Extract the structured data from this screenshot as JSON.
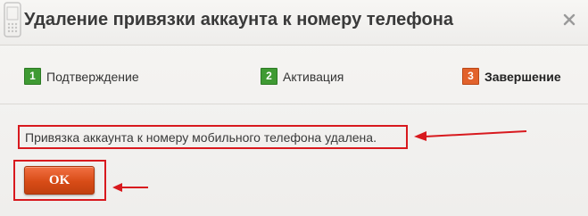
{
  "dialog": {
    "title": "Удаление привязки аккаунта к номеру телефона"
  },
  "steps": [
    {
      "number": "1",
      "label": "Подтверждение",
      "state": "done",
      "color": "#3f9a33"
    },
    {
      "number": "2",
      "label": "Активация",
      "state": "done",
      "color": "#3f9a33"
    },
    {
      "number": "3",
      "label": "Завершение",
      "state": "current",
      "color": "#e2622c"
    }
  ],
  "message": "Привязка аккаунта к номеру мобильного телефона удалена.",
  "ok_button": {
    "label": "OK"
  },
  "annotation_color": "#d8191e",
  "icons": {
    "phone": "phone-icon",
    "close": "close-icon",
    "arrows": "arrow-icon"
  }
}
